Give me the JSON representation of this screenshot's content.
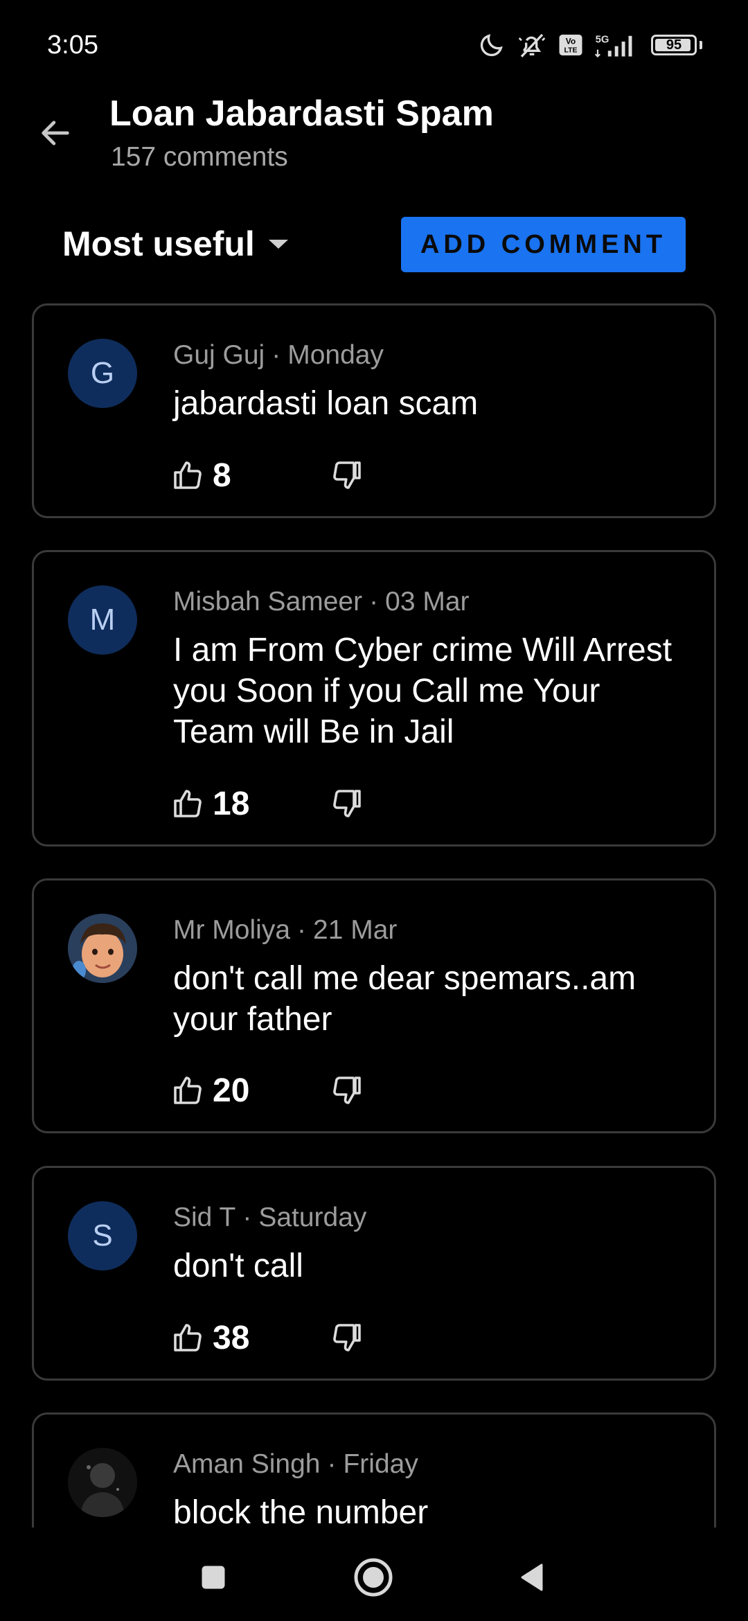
{
  "status_bar": {
    "time": "3:05",
    "network": "5G",
    "battery": "95",
    "battery_fraction": 0.95,
    "icons": [
      "moon-icon",
      "bell-off-icon",
      "volte-icon",
      "signal-5g-icon",
      "battery-icon"
    ]
  },
  "header": {
    "back_icon": "arrow-left-icon",
    "title": "Loan Jabardasti Spam",
    "subtitle": "157 comments"
  },
  "toolbar": {
    "sort_label": "Most useful",
    "sort_icon": "caret-down-icon",
    "add_comment_label": "ADD COMMENT",
    "accent_color": "#1a73f0"
  },
  "comments": [
    {
      "author": "Guj Guj",
      "date": "Monday",
      "avatar_initial": "G",
      "text": "jabardasti loan scam",
      "likes": "8"
    },
    {
      "author": "Misbah Sameer",
      "date": "03 Mar",
      "avatar_initial": "M",
      "text": "I am From Cyber crime Will Arrest you Soon if you Call me Your Team will Be in Jail",
      "likes": "18"
    },
    {
      "author": "Mr Moliya",
      "date": "21 Mar",
      "avatar_initial": "",
      "text": "don't call me dear spemars..am your father",
      "likes": "20"
    },
    {
      "author": "Sid T",
      "date": "Saturday",
      "avatar_initial": "S",
      "text": "don't call",
      "likes": "38"
    },
    {
      "author": "Aman Singh",
      "date": "Friday",
      "avatar_initial": "",
      "text": "block the number",
      "likes": ""
    }
  ],
  "meta_separator": "·",
  "nav_bar": {
    "icons": [
      "recents-square-icon",
      "home-circle-icon",
      "back-triangle-icon"
    ]
  }
}
